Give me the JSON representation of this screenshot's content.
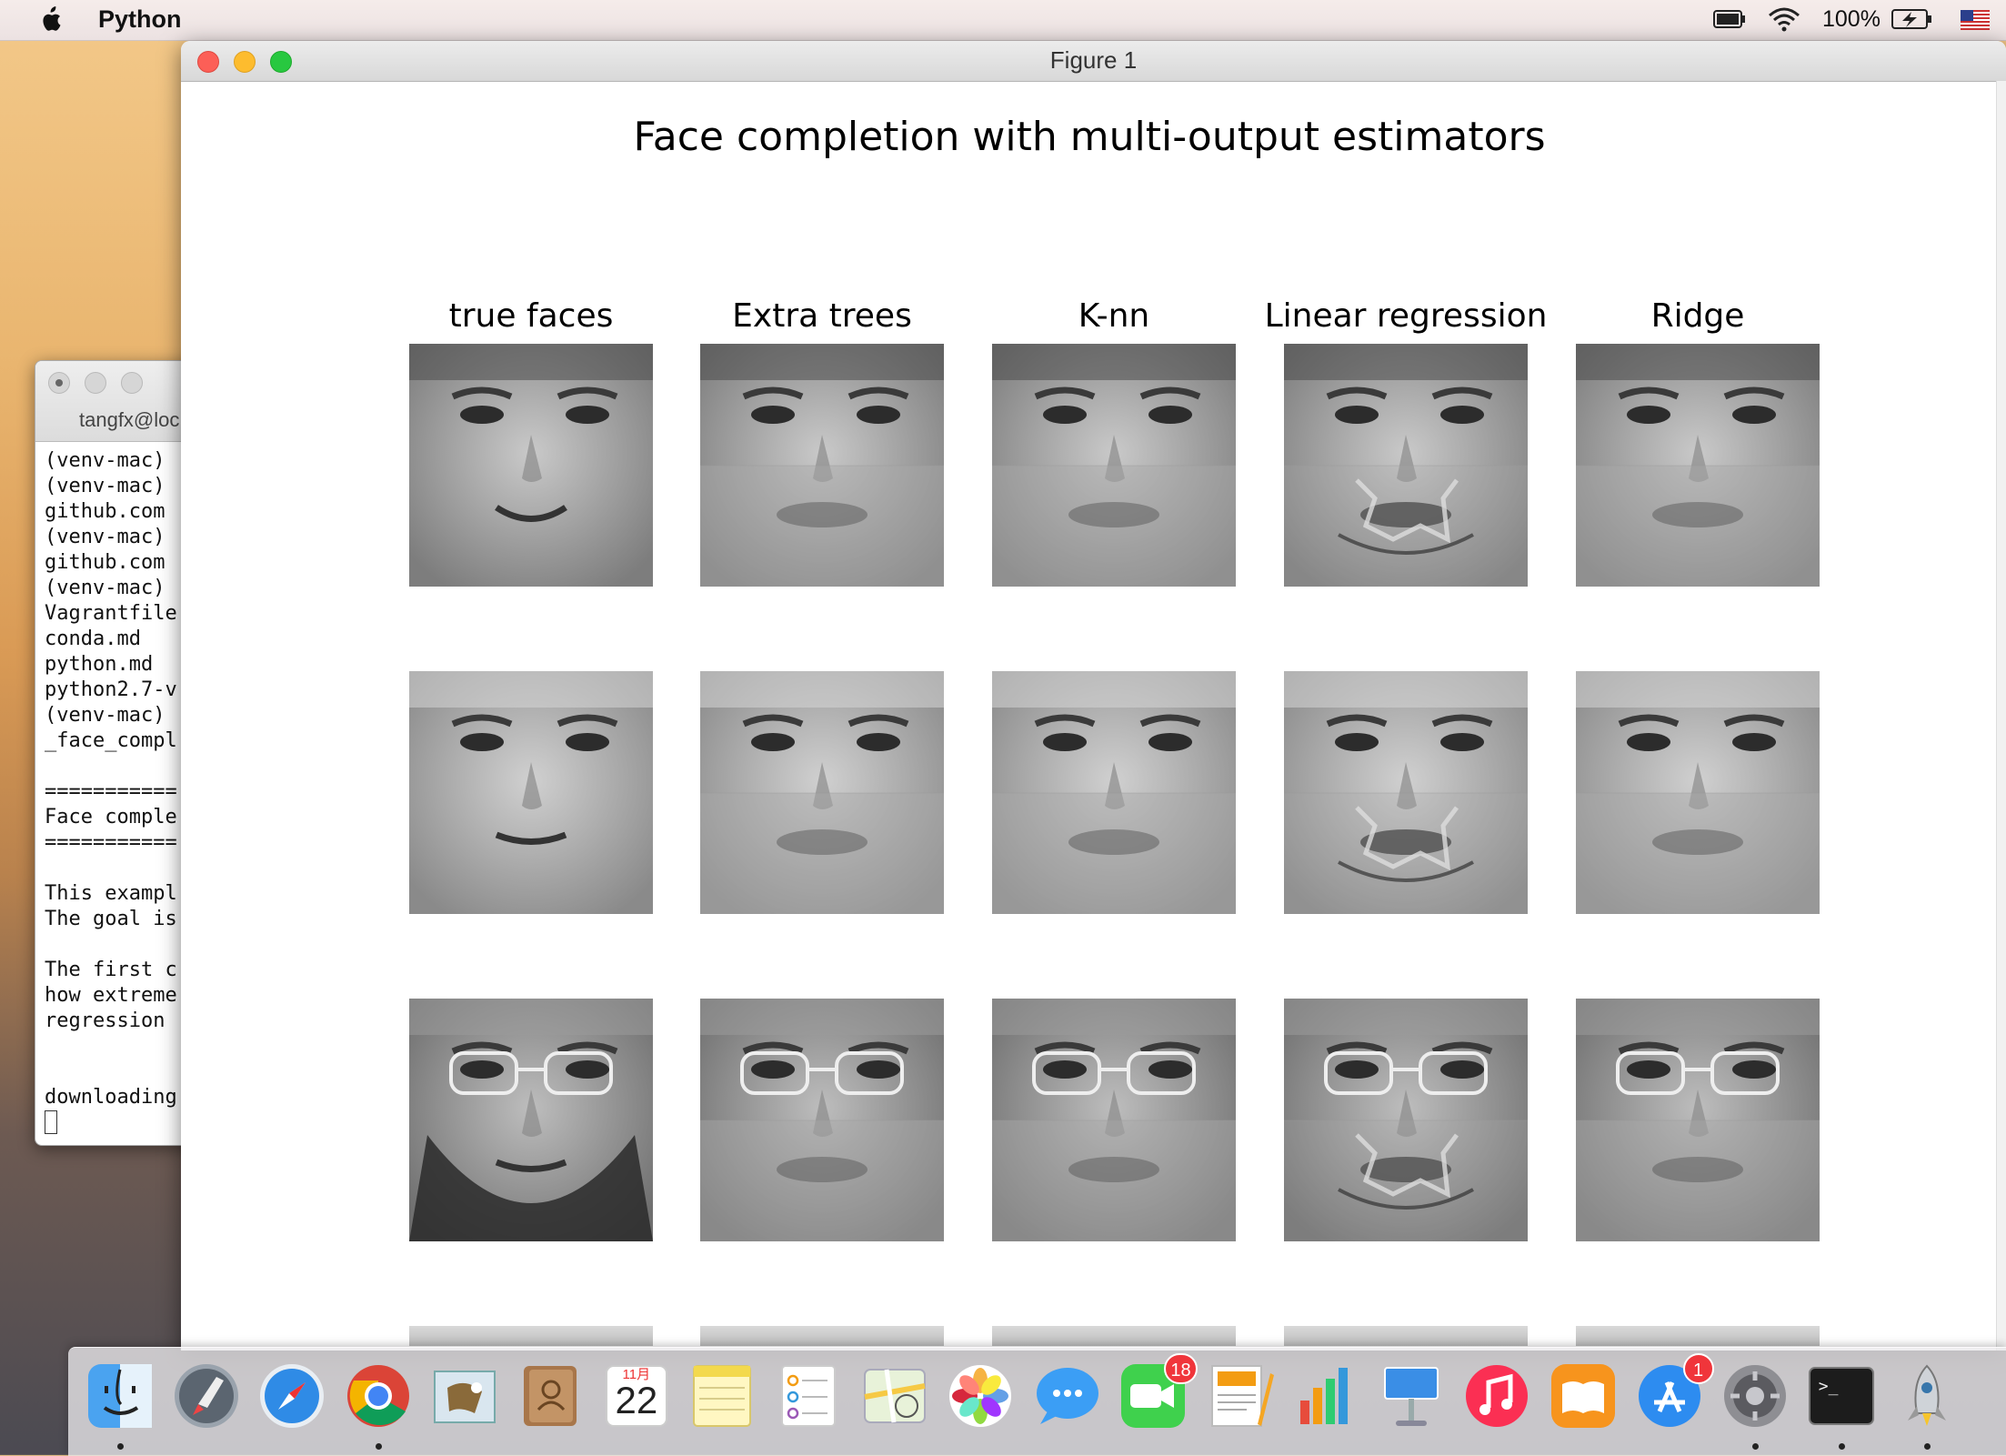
{
  "menubar": {
    "app_name": "Python",
    "battery_percent": "100%"
  },
  "terminal": {
    "title": "tangfx@loc",
    "lines": [
      "(venv-mac)",
      "(venv-mac)",
      "github.com",
      "(venv-mac)",
      "github.com",
      "(venv-mac)",
      "Vagrantfile",
      "conda.md",
      "python.md",
      "python2.7-v",
      "(venv-mac)",
      "_face_compl",
      "",
      "===========",
      "Face comple",
      "===========",
      "",
      "This exampl",
      "The goal is",
      "",
      "The first c",
      "how extreme",
      "regression",
      "",
      "",
      "downloading"
    ]
  },
  "figure": {
    "window_title": "Figure 1",
    "suptitle": "Face completion with multi-output estimators",
    "columns": [
      "true faces",
      "Extra trees",
      "K-nn",
      "Linear regression",
      "Ridge"
    ],
    "rows_visible": 3,
    "row_partially_visible": 1
  },
  "dock": {
    "items": [
      {
        "name": "Finder",
        "icon": "finder-icon",
        "running": true
      },
      {
        "name": "Launchpad",
        "icon": "launchpad-icon",
        "running": false
      },
      {
        "name": "Safari",
        "icon": "safari-icon",
        "running": false
      },
      {
        "name": "Google Chrome",
        "icon": "chrome-icon",
        "running": true
      },
      {
        "name": "Mail",
        "icon": "mail-icon",
        "running": false
      },
      {
        "name": "Contacts",
        "icon": "contacts-icon",
        "running": false
      },
      {
        "name": "Calendar",
        "icon": "calendar-icon",
        "running": false,
        "month": "11月",
        "day": "22"
      },
      {
        "name": "Notes",
        "icon": "notes-icon",
        "running": false
      },
      {
        "name": "Reminders",
        "icon": "reminders-icon",
        "running": false
      },
      {
        "name": "Maps",
        "icon": "maps-icon",
        "running": false
      },
      {
        "name": "Photos",
        "icon": "photos-icon",
        "running": false
      },
      {
        "name": "Messages",
        "icon": "messages-icon",
        "running": false
      },
      {
        "name": "FaceTime",
        "icon": "facetime-icon",
        "running": false,
        "badge": "18"
      },
      {
        "name": "Pages",
        "icon": "pages-icon",
        "running": false
      },
      {
        "name": "Numbers",
        "icon": "numbers-icon",
        "running": false
      },
      {
        "name": "Keynote",
        "icon": "keynote-icon",
        "running": false
      },
      {
        "name": "iTunes",
        "icon": "itunes-icon",
        "running": false
      },
      {
        "name": "iBooks",
        "icon": "ibooks-icon",
        "running": false
      },
      {
        "name": "App Store",
        "icon": "app-store-icon",
        "running": false,
        "badge": "1"
      },
      {
        "name": "System Preferences",
        "icon": "system-preferences-icon",
        "running": true
      },
      {
        "name": "Terminal",
        "icon": "terminal-icon",
        "running": true,
        "prompt": ">_"
      },
      {
        "name": "Python Launcher",
        "icon": "python-rocket-icon",
        "running": true
      }
    ]
  }
}
